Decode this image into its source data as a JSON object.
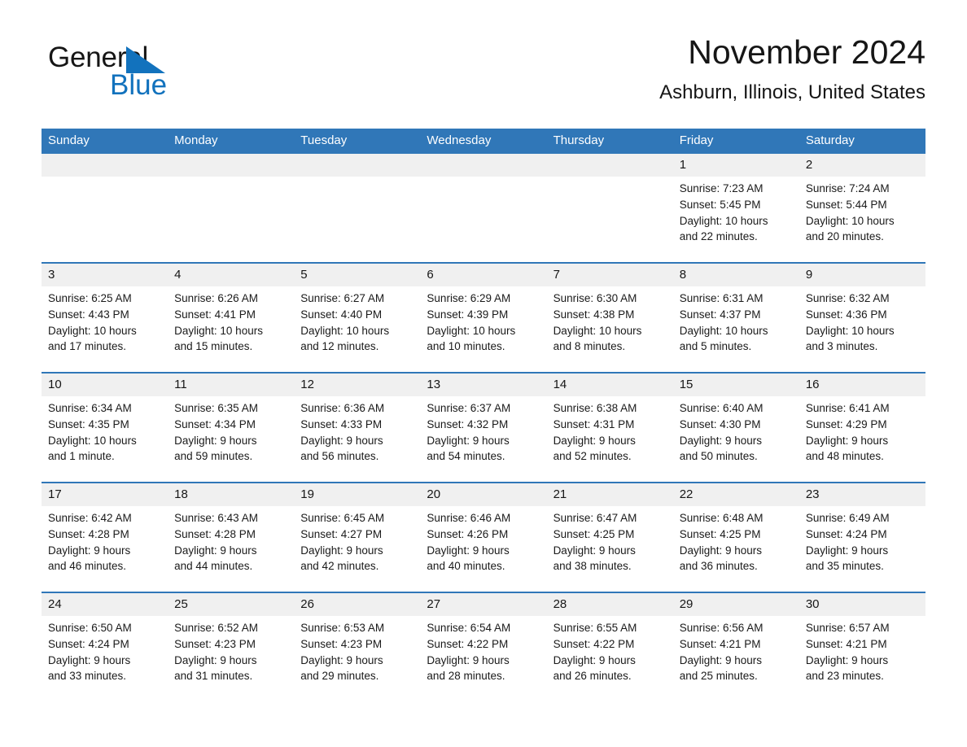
{
  "logo": {
    "line1": "General",
    "line2": "Blue",
    "triangle_color": "#1272bd"
  },
  "header": {
    "title": "November 2024",
    "subtitle": "Ashburn, Illinois, United States"
  },
  "colors": {
    "header_blue": "#3077b8",
    "daynum_band": "#f0f0f0",
    "text": "#161616"
  },
  "weekdays": [
    "Sunday",
    "Monday",
    "Tuesday",
    "Wednesday",
    "Thursday",
    "Friday",
    "Saturday"
  ],
  "labels": {
    "sunrise_prefix": "Sunrise:",
    "sunset_prefix": "Sunset:",
    "daylight_prefix": "Daylight:"
  },
  "weeks": [
    [
      {
        "day": "",
        "sunrise": "",
        "sunset": "",
        "daylight_line1": "",
        "daylight_line2": ""
      },
      {
        "day": "",
        "sunrise": "",
        "sunset": "",
        "daylight_line1": "",
        "daylight_line2": ""
      },
      {
        "day": "",
        "sunrise": "",
        "sunset": "",
        "daylight_line1": "",
        "daylight_line2": ""
      },
      {
        "day": "",
        "sunrise": "",
        "sunset": "",
        "daylight_line1": "",
        "daylight_line2": ""
      },
      {
        "day": "",
        "sunrise": "",
        "sunset": "",
        "daylight_line1": "",
        "daylight_line2": ""
      },
      {
        "day": "1",
        "sunrise": "Sunrise: 7:23 AM",
        "sunset": "Sunset: 5:45 PM",
        "daylight_line1": "Daylight: 10 hours",
        "daylight_line2": "and 22 minutes."
      },
      {
        "day": "2",
        "sunrise": "Sunrise: 7:24 AM",
        "sunset": "Sunset: 5:44 PM",
        "daylight_line1": "Daylight: 10 hours",
        "daylight_line2": "and 20 minutes."
      }
    ],
    [
      {
        "day": "3",
        "sunrise": "Sunrise: 6:25 AM",
        "sunset": "Sunset: 4:43 PM",
        "daylight_line1": "Daylight: 10 hours",
        "daylight_line2": "and 17 minutes."
      },
      {
        "day": "4",
        "sunrise": "Sunrise: 6:26 AM",
        "sunset": "Sunset: 4:41 PM",
        "daylight_line1": "Daylight: 10 hours",
        "daylight_line2": "and 15 minutes."
      },
      {
        "day": "5",
        "sunrise": "Sunrise: 6:27 AM",
        "sunset": "Sunset: 4:40 PM",
        "daylight_line1": "Daylight: 10 hours",
        "daylight_line2": "and 12 minutes."
      },
      {
        "day": "6",
        "sunrise": "Sunrise: 6:29 AM",
        "sunset": "Sunset: 4:39 PM",
        "daylight_line1": "Daylight: 10 hours",
        "daylight_line2": "and 10 minutes."
      },
      {
        "day": "7",
        "sunrise": "Sunrise: 6:30 AM",
        "sunset": "Sunset: 4:38 PM",
        "daylight_line1": "Daylight: 10 hours",
        "daylight_line2": "and 8 minutes."
      },
      {
        "day": "8",
        "sunrise": "Sunrise: 6:31 AM",
        "sunset": "Sunset: 4:37 PM",
        "daylight_line1": "Daylight: 10 hours",
        "daylight_line2": "and 5 minutes."
      },
      {
        "day": "9",
        "sunrise": "Sunrise: 6:32 AM",
        "sunset": "Sunset: 4:36 PM",
        "daylight_line1": "Daylight: 10 hours",
        "daylight_line2": "and 3 minutes."
      }
    ],
    [
      {
        "day": "10",
        "sunrise": "Sunrise: 6:34 AM",
        "sunset": "Sunset: 4:35 PM",
        "daylight_line1": "Daylight: 10 hours",
        "daylight_line2": "and 1 minute."
      },
      {
        "day": "11",
        "sunrise": "Sunrise: 6:35 AM",
        "sunset": "Sunset: 4:34 PM",
        "daylight_line1": "Daylight: 9 hours",
        "daylight_line2": "and 59 minutes."
      },
      {
        "day": "12",
        "sunrise": "Sunrise: 6:36 AM",
        "sunset": "Sunset: 4:33 PM",
        "daylight_line1": "Daylight: 9 hours",
        "daylight_line2": "and 56 minutes."
      },
      {
        "day": "13",
        "sunrise": "Sunrise: 6:37 AM",
        "sunset": "Sunset: 4:32 PM",
        "daylight_line1": "Daylight: 9 hours",
        "daylight_line2": "and 54 minutes."
      },
      {
        "day": "14",
        "sunrise": "Sunrise: 6:38 AM",
        "sunset": "Sunset: 4:31 PM",
        "daylight_line1": "Daylight: 9 hours",
        "daylight_line2": "and 52 minutes."
      },
      {
        "day": "15",
        "sunrise": "Sunrise: 6:40 AM",
        "sunset": "Sunset: 4:30 PM",
        "daylight_line1": "Daylight: 9 hours",
        "daylight_line2": "and 50 minutes."
      },
      {
        "day": "16",
        "sunrise": "Sunrise: 6:41 AM",
        "sunset": "Sunset: 4:29 PM",
        "daylight_line1": "Daylight: 9 hours",
        "daylight_line2": "and 48 minutes."
      }
    ],
    [
      {
        "day": "17",
        "sunrise": "Sunrise: 6:42 AM",
        "sunset": "Sunset: 4:28 PM",
        "daylight_line1": "Daylight: 9 hours",
        "daylight_line2": "and 46 minutes."
      },
      {
        "day": "18",
        "sunrise": "Sunrise: 6:43 AM",
        "sunset": "Sunset: 4:28 PM",
        "daylight_line1": "Daylight: 9 hours",
        "daylight_line2": "and 44 minutes."
      },
      {
        "day": "19",
        "sunrise": "Sunrise: 6:45 AM",
        "sunset": "Sunset: 4:27 PM",
        "daylight_line1": "Daylight: 9 hours",
        "daylight_line2": "and 42 minutes."
      },
      {
        "day": "20",
        "sunrise": "Sunrise: 6:46 AM",
        "sunset": "Sunset: 4:26 PM",
        "daylight_line1": "Daylight: 9 hours",
        "daylight_line2": "and 40 minutes."
      },
      {
        "day": "21",
        "sunrise": "Sunrise: 6:47 AM",
        "sunset": "Sunset: 4:25 PM",
        "daylight_line1": "Daylight: 9 hours",
        "daylight_line2": "and 38 minutes."
      },
      {
        "day": "22",
        "sunrise": "Sunrise: 6:48 AM",
        "sunset": "Sunset: 4:25 PM",
        "daylight_line1": "Daylight: 9 hours",
        "daylight_line2": "and 36 minutes."
      },
      {
        "day": "23",
        "sunrise": "Sunrise: 6:49 AM",
        "sunset": "Sunset: 4:24 PM",
        "daylight_line1": "Daylight: 9 hours",
        "daylight_line2": "and 35 minutes."
      }
    ],
    [
      {
        "day": "24",
        "sunrise": "Sunrise: 6:50 AM",
        "sunset": "Sunset: 4:24 PM",
        "daylight_line1": "Daylight: 9 hours",
        "daylight_line2": "and 33 minutes."
      },
      {
        "day": "25",
        "sunrise": "Sunrise: 6:52 AM",
        "sunset": "Sunset: 4:23 PM",
        "daylight_line1": "Daylight: 9 hours",
        "daylight_line2": "and 31 minutes."
      },
      {
        "day": "26",
        "sunrise": "Sunrise: 6:53 AM",
        "sunset": "Sunset: 4:23 PM",
        "daylight_line1": "Daylight: 9 hours",
        "daylight_line2": "and 29 minutes."
      },
      {
        "day": "27",
        "sunrise": "Sunrise: 6:54 AM",
        "sunset": "Sunset: 4:22 PM",
        "daylight_line1": "Daylight: 9 hours",
        "daylight_line2": "and 28 minutes."
      },
      {
        "day": "28",
        "sunrise": "Sunrise: 6:55 AM",
        "sunset": "Sunset: 4:22 PM",
        "daylight_line1": "Daylight: 9 hours",
        "daylight_line2": "and 26 minutes."
      },
      {
        "day": "29",
        "sunrise": "Sunrise: 6:56 AM",
        "sunset": "Sunset: 4:21 PM",
        "daylight_line1": "Daylight: 9 hours",
        "daylight_line2": "and 25 minutes."
      },
      {
        "day": "30",
        "sunrise": "Sunrise: 6:57 AM",
        "sunset": "Sunset: 4:21 PM",
        "daylight_line1": "Daylight: 9 hours",
        "daylight_line2": "and 23 minutes."
      }
    ]
  ]
}
